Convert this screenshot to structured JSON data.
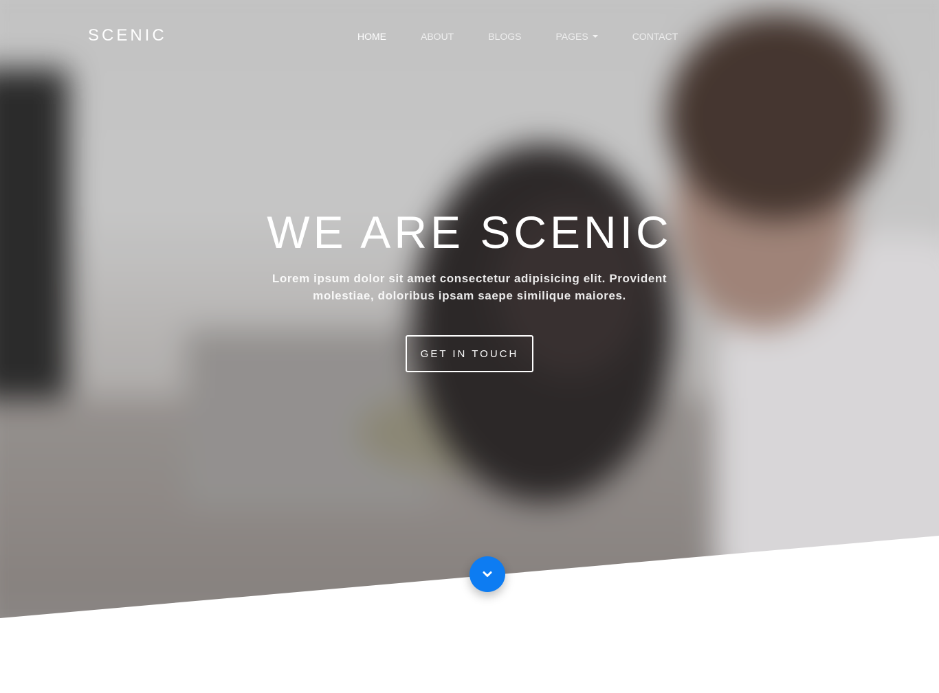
{
  "brand": {
    "name": "SCENIC"
  },
  "nav": {
    "items": [
      {
        "label": "HOME",
        "active": true
      },
      {
        "label": "ABOUT"
      },
      {
        "label": "BLOGS"
      },
      {
        "label": "PAGES",
        "has_dropdown": true
      },
      {
        "label": "CONTACT"
      }
    ]
  },
  "hero": {
    "title": "WE ARE SCENIC",
    "subtitle": "Lorem ipsum dolor sit amet consectetur adipisicing elit. Provident molestiae, doloribus ipsam saepe similique maiores.",
    "cta_label": "GET IN TOUCH",
    "scroll_icon": "chevron-down-icon"
  },
  "colors": {
    "accent": "#0d7cf2",
    "text_light": "#ffffff",
    "page_bg": "#ffffff"
  }
}
